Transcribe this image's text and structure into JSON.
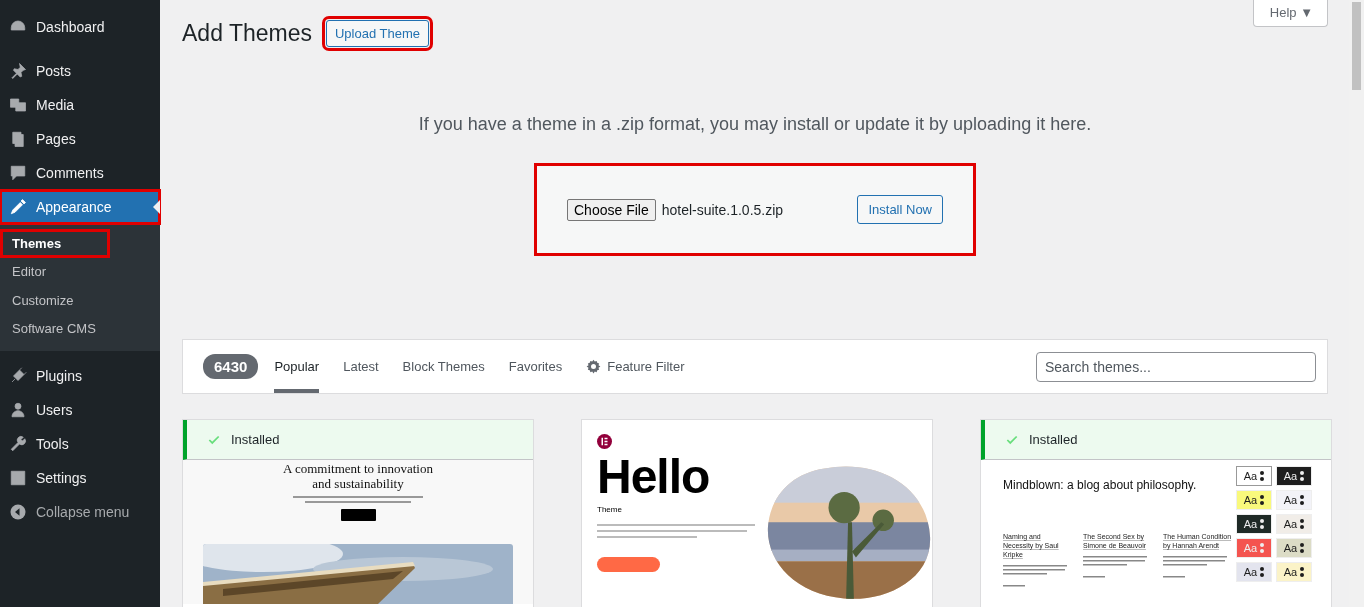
{
  "sidebar": {
    "items": [
      {
        "label": "Dashboard",
        "selected": false,
        "highlighted": false
      },
      {
        "label": "Posts",
        "selected": false,
        "highlighted": false
      },
      {
        "label": "Media",
        "selected": false,
        "highlighted": false
      },
      {
        "label": "Pages",
        "selected": false,
        "highlighted": false
      },
      {
        "label": "Comments",
        "selected": false,
        "highlighted": false
      },
      {
        "label": "Appearance",
        "selected": true,
        "highlighted": true,
        "children": [
          {
            "label": "Themes",
            "selected": true,
            "highlighted": true
          },
          {
            "label": "Editor",
            "selected": false,
            "highlighted": false
          },
          {
            "label": "Customize",
            "selected": false,
            "highlighted": false
          },
          {
            "label": "Software CMS",
            "selected": false,
            "highlighted": false
          }
        ]
      },
      {
        "label": "Plugins",
        "selected": false,
        "highlighted": false
      },
      {
        "label": "Users",
        "selected": false,
        "highlighted": false
      },
      {
        "label": "Tools",
        "selected": false,
        "highlighted": false
      },
      {
        "label": "Settings",
        "selected": false,
        "highlighted": false
      }
    ],
    "collapse": "Collapse menu"
  },
  "header": {
    "title": "Add Themes",
    "upload_button": {
      "label": "Upload Theme",
      "highlighted": true
    },
    "help": "Help ▼"
  },
  "upload": {
    "intro": "If you have a theme in a .zip format, you may install or update it by uploading it here.",
    "choose_button": "Choose File",
    "file_name": "hotel-suite.1.0.5.zip",
    "install_button": "Install Now",
    "highlighted": true
  },
  "filter_bar": {
    "count": "6430",
    "tabs": [
      {
        "label": "Popular",
        "kind": "tab",
        "selected": true
      },
      {
        "label": "Latest",
        "kind": "tab",
        "selected": false
      },
      {
        "label": "Block Themes",
        "kind": "tab",
        "selected": false
      },
      {
        "label": "Favorites",
        "kind": "tab",
        "selected": false
      },
      {
        "label": "Feature Filter",
        "kind": "filter",
        "selected": false
      }
    ],
    "search": {
      "placeholder": "Search themes..."
    }
  },
  "themes": [
    {
      "installed": true,
      "status": "Installed",
      "kind": "architecture",
      "heading": "A commitment to innovation and sustainability"
    },
    {
      "installed": false,
      "kind": "hello",
      "heading": "Hello",
      "subheading": "Theme"
    },
    {
      "installed": true,
      "status": "Installed",
      "kind": "blog",
      "heading": "Mindblown: a blog about philosophy.",
      "posts": [
        {
          "title": "Naming and Necessity by Saul Kripke"
        },
        {
          "title": "The Second Sex by Simone de Beauvoir"
        },
        {
          "title": "The Human Condition by Hannah Arendt"
        }
      ],
      "styles": [
        {
          "label": "Aa",
          "color": "#ffffff",
          "selected": true
        },
        {
          "label": "Aa",
          "color": "#1e1e1e",
          "selected": false
        },
        {
          "label": "Aa",
          "color": "#f9f97c",
          "selected": false
        },
        {
          "label": "Aa",
          "color": "#f3f3f8",
          "selected": false
        },
        {
          "label": "Aa",
          "color": "#1f2a26",
          "selected": false
        },
        {
          "label": "Aa",
          "color": "#f1ede8",
          "selected": false
        },
        {
          "label": "Aa",
          "color": "#f4544f",
          "selected": false
        },
        {
          "label": "Aa",
          "color": "#dcdcc6",
          "selected": false
        },
        {
          "label": "Aa",
          "color": "#e3e4ee",
          "selected": false
        },
        {
          "label": "Aa",
          "color": "#fbf3c8",
          "selected": false
        }
      ]
    }
  ]
}
